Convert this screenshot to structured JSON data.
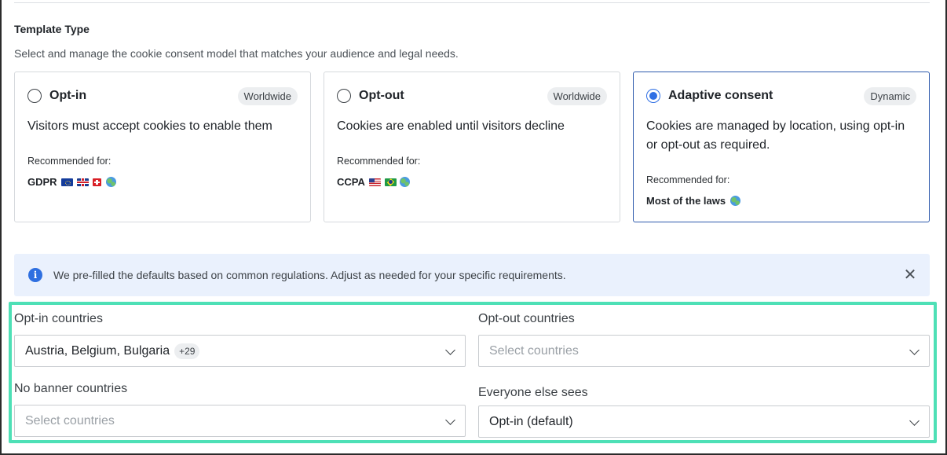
{
  "section": {
    "title": "Template Type",
    "description": "Select and manage the cookie consent model that matches your audience and legal needs."
  },
  "cards": [
    {
      "title": "Opt-in",
      "badge": "Worldwide",
      "description": "Visitors must accept cookies to enable them",
      "recommended_label": "Recommended for:",
      "recommended_value": "GDPR",
      "icons": [
        "eu-flag-icon",
        "uk-flag-icon",
        "swiss-flag-icon",
        "globe-icon"
      ],
      "selected": false
    },
    {
      "title": "Opt-out",
      "badge": "Worldwide",
      "description": "Cookies are enabled until visitors decline",
      "recommended_label": "Recommended for:",
      "recommended_value": "CCPA",
      "icons": [
        "us-flag-icon",
        "brazil-flag-icon",
        "globe-icon"
      ],
      "selected": false
    },
    {
      "title": "Adaptive consent",
      "badge": "Dynamic",
      "description": "Cookies are managed by location, using opt-in or opt-out as required.",
      "recommended_label": "Recommended for:",
      "recommended_value": "Most of the laws",
      "icons": [
        "globe-icon"
      ],
      "selected": true
    }
  ],
  "info": {
    "text": "We pre-filled the defaults based on common regulations. Adjust as needed for your specific requirements.",
    "icon": "info-icon",
    "close_icon": "close-icon"
  },
  "fields": {
    "opt_in": {
      "label": "Opt-in countries",
      "value": "Austria, Belgium, Bulgaria",
      "more": "+29"
    },
    "opt_out": {
      "label": "Opt-out countries",
      "placeholder": "Select countries"
    },
    "no_banner": {
      "label": "No banner countries",
      "placeholder": "Select countries"
    },
    "everyone_else": {
      "label": "Everyone else sees",
      "value": "Opt-in (default)"
    }
  },
  "colors": {
    "accent": "#2f6fe4",
    "selected_border": "#2e5aac",
    "info_bg": "#eaf1fd",
    "highlight": "#4ee0b6"
  }
}
